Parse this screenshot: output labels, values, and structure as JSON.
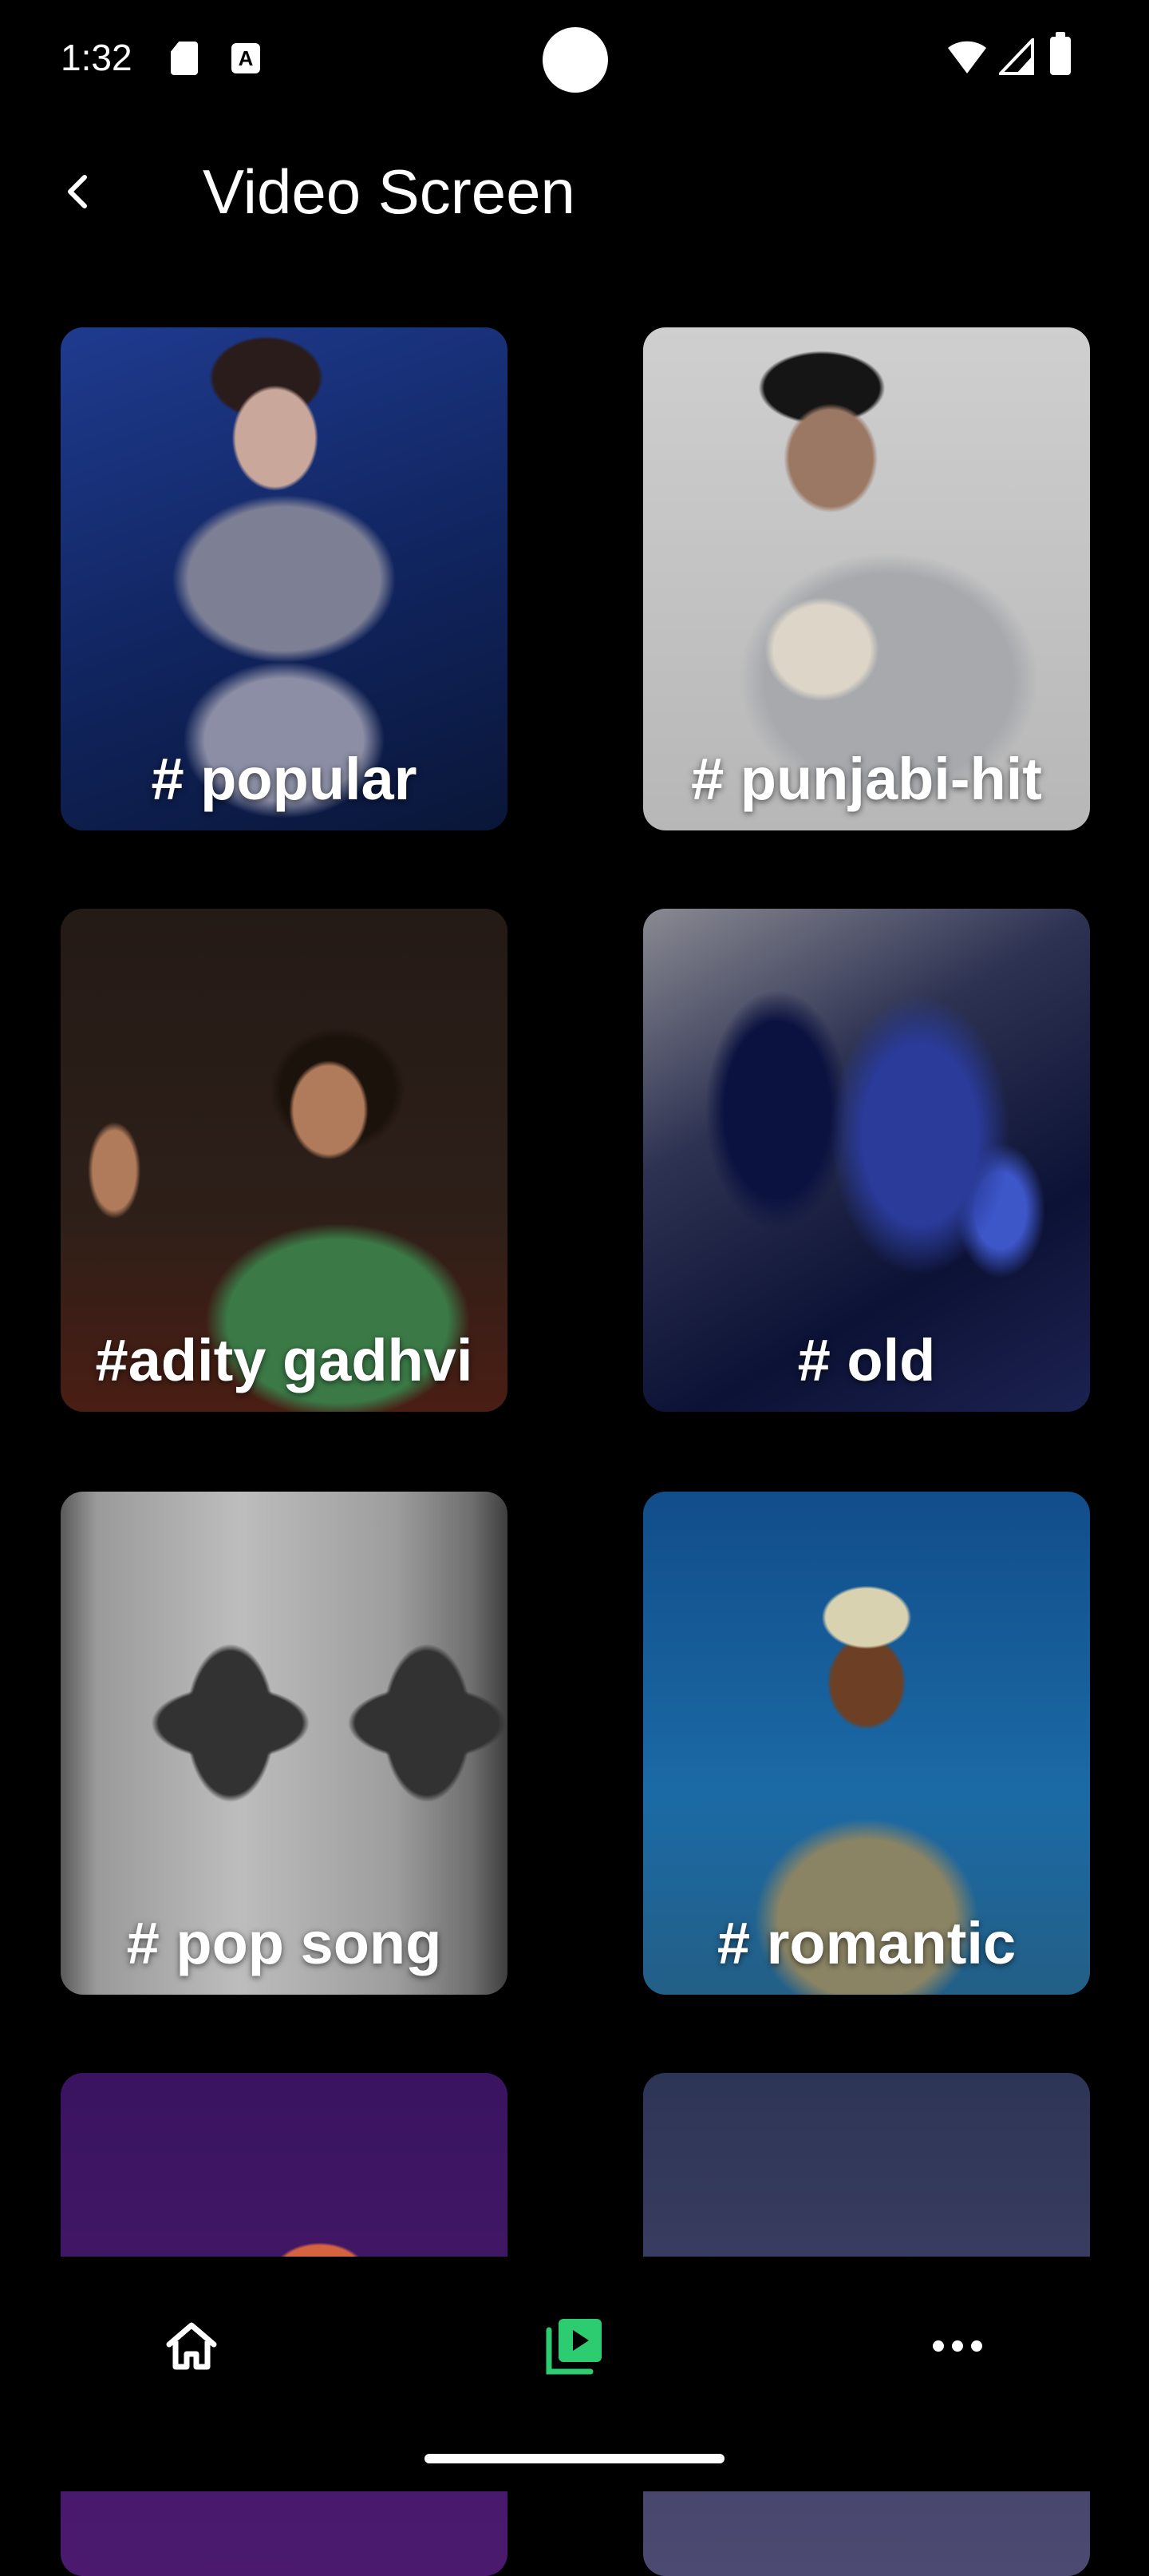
{
  "status_bar": {
    "time": "1:32",
    "icons": [
      "sd-card-icon",
      "a-icon",
      "wifi-icon",
      "signal-icon",
      "battery-icon"
    ],
    "a_glyph": "A"
  },
  "header": {
    "title": "Video Screen",
    "back_icon": "chevron-left-icon"
  },
  "cards": [
    {
      "label": "# popular"
    },
    {
      "label": "# punjabi-hit"
    },
    {
      "label": "#adity gadhvi"
    },
    {
      "label": "# old"
    },
    {
      "label": "# pop song"
    },
    {
      "label": "# romantic"
    }
  ],
  "bottom_nav": {
    "items": [
      {
        "icon": "home-icon",
        "active": false
      },
      {
        "icon": "video-library-icon",
        "active": true
      },
      {
        "icon": "more-horizontal-icon",
        "active": false
      }
    ],
    "active_color": "#2ecc71",
    "inactive_color": "#ffffff"
  },
  "colors": {
    "background": "#000000",
    "text": "#ffffff",
    "accent": "#2ecc71"
  }
}
